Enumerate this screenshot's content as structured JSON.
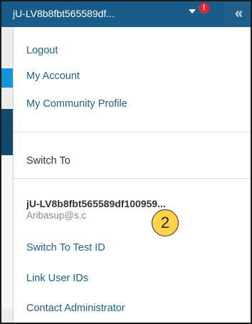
{
  "header": {
    "user_label": "jU-LV8b8fbt565589df...",
    "alert_mark": "!",
    "collapse_glyph": "«"
  },
  "menu": {
    "logout": "Logout",
    "my_account": "My Account",
    "my_community_profile": "My Community Profile",
    "switch_to": "Switch To",
    "account": {
      "id": "jU-LV8b8fbt565589df100959...",
      "email": "Aribasup@s.c"
    },
    "switch_to_test_id": "Switch To Test ID",
    "link_user_ids": "Link User IDs",
    "contact_administrator": "Contact Administrator"
  },
  "callout": {
    "step_number": "2"
  },
  "colors": {
    "header_bg": "#1a5c89",
    "link": "#1f5f8b",
    "alert": "#e2252f",
    "callout_fill": "#ffd24a"
  },
  "icons": {
    "caret": "chevron-down-icon",
    "alert": "alert-icon",
    "collapse": "double-chevron-left-icon"
  }
}
